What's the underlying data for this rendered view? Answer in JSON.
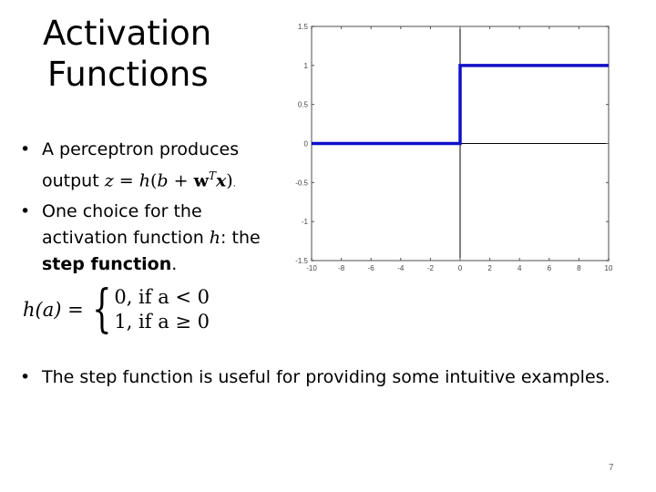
{
  "slide": {
    "title_line1": "Activation",
    "title_line2": "Functions",
    "bullets": [
      {
        "text_prefix": "A perceptron produces output ",
        "equation": "z = h(b + w^T x)",
        "eq_z": "z",
        "eq_eq": " = ",
        "eq_h": "h",
        "eq_open": "(",
        "eq_b": "b",
        "eq_plus": " + ",
        "eq_w": "w",
        "eq_T": "T",
        "eq_x": "x",
        "eq_close": ")",
        "text_suffix": "."
      },
      {
        "text_prefix": "One choice for the activation function ",
        "var": "h",
        "text_mid": ": the ",
        "bold": "step function",
        "text_suffix": "."
      }
    ],
    "formula": {
      "lhs": "h(a) = ",
      "case1": "0, if a < 0",
      "case2": "1, if a ≥ 0"
    },
    "bottom_bullet": "The step function is useful for providing some intuitive examples.",
    "bullet_glyph": "•",
    "page_number": "7"
  },
  "chart_data": {
    "type": "line",
    "title": "",
    "xlabel": "",
    "ylabel": "",
    "xlim": [
      -10,
      10
    ],
    "ylim": [
      -1.5,
      1.5
    ],
    "x_ticks": [
      -10,
      -8,
      -6,
      -4,
      -2,
      0,
      2,
      4,
      6,
      8,
      10
    ],
    "y_ticks": [
      -1.5,
      -1,
      -0.5,
      0,
      0.5,
      1,
      1.5
    ],
    "x_tick_labels": [
      "-10",
      "-8",
      "-6",
      "-4",
      "-2",
      "0",
      "2",
      "4",
      "6",
      "8",
      "10"
    ],
    "y_tick_labels": [
      "-1.5",
      "-1",
      "-0.5",
      "0",
      "0.5",
      "1",
      "1.5"
    ],
    "grid": false,
    "axis_lines": {
      "x_zero": true,
      "y_zero": true
    },
    "series": [
      {
        "name": "step function",
        "color": "#1010c8",
        "x": [
          -10,
          0,
          0,
          10
        ],
        "y": [
          0,
          0,
          1,
          1
        ]
      }
    ]
  }
}
